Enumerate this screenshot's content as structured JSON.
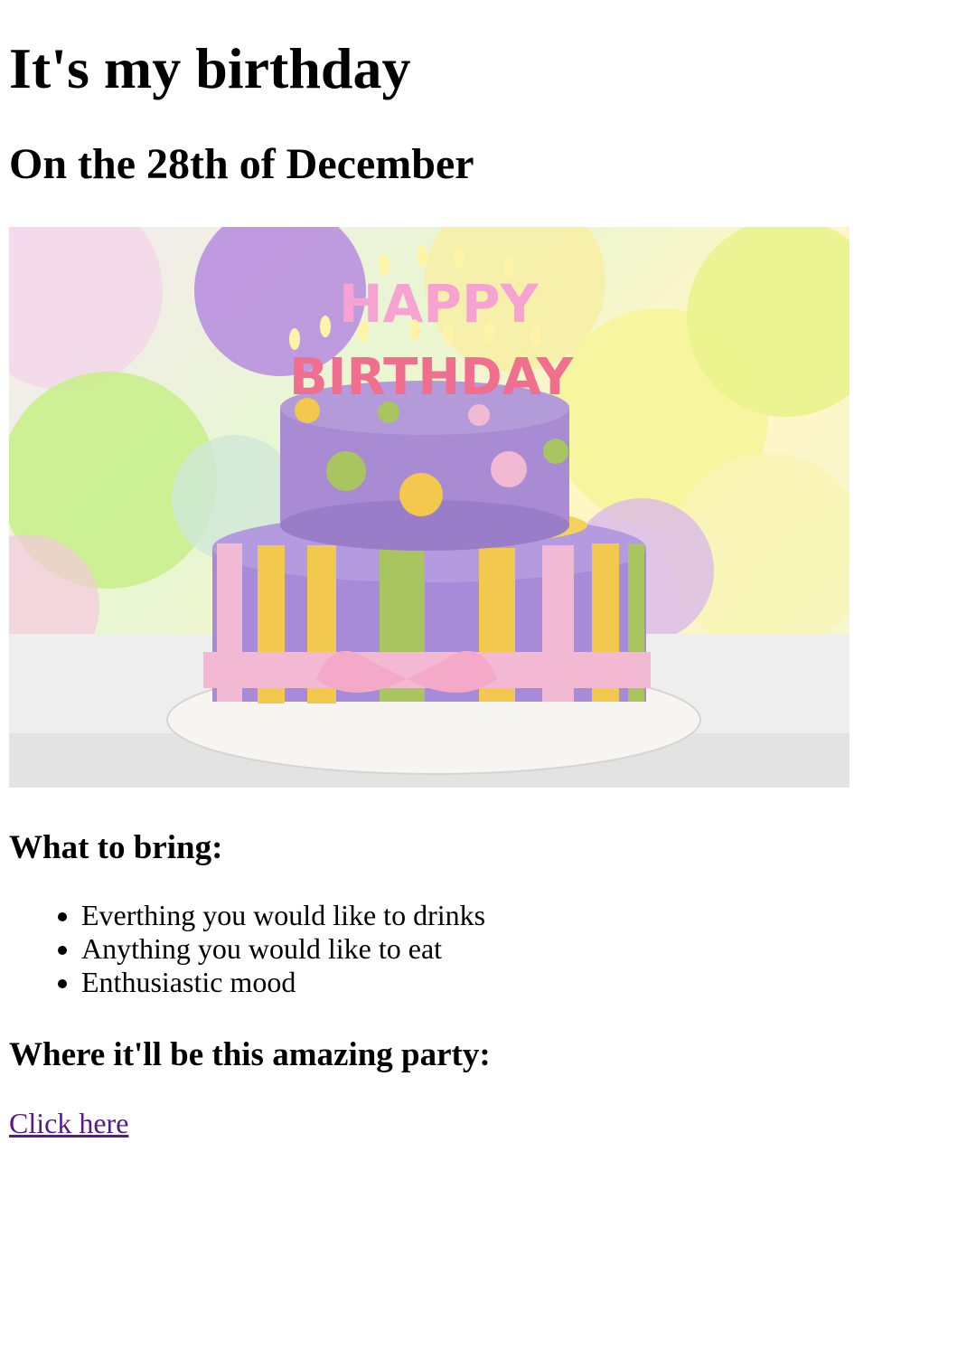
{
  "header": {
    "title": "It's my birthday",
    "subtitle": "On the 28th of December"
  },
  "hero": {
    "image_name": "birthday-cake-image",
    "candle_letters_top": "HAPPY",
    "candle_letters_bottom": "BIRTHDAY"
  },
  "bring": {
    "heading": "What to bring:",
    "items": [
      "Everthing you would like to drinks",
      "Anything you would like to eat",
      "Enthusiastic mood"
    ]
  },
  "location": {
    "heading": "Where it'll be this amazing party:",
    "link_label": "Click here"
  },
  "colors": {
    "link_visited": "#551a8b",
    "text": "#000000",
    "background": "#ffffff"
  }
}
